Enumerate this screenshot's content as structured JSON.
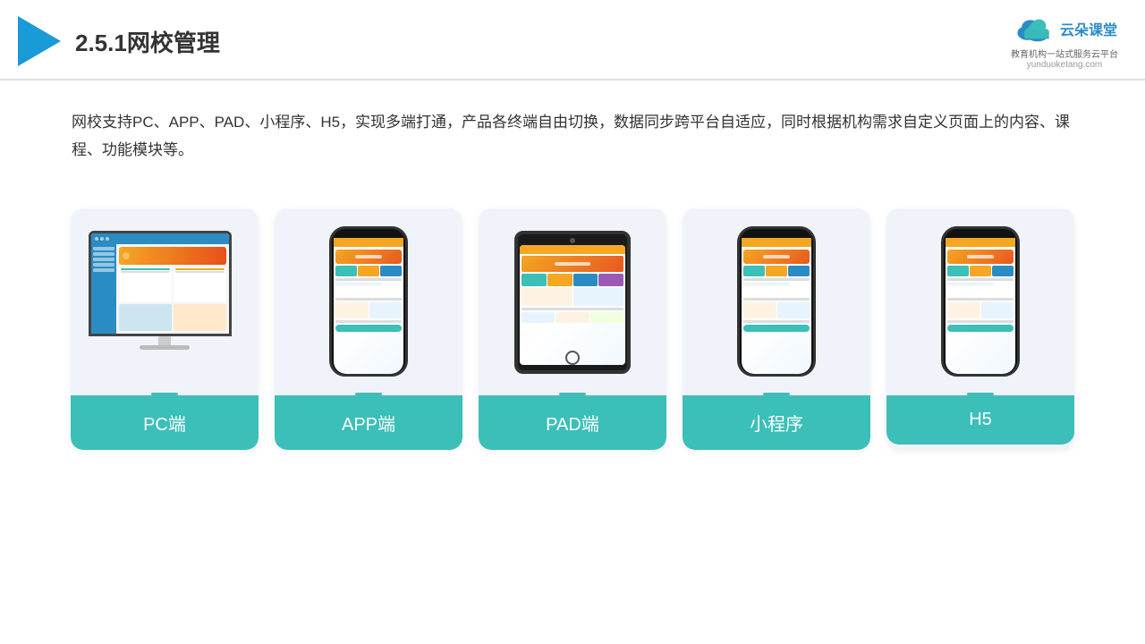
{
  "header": {
    "title": "2.5.1网校管理",
    "brand": {
      "name": "云朵课堂",
      "url": "yunduoketang.com",
      "tagline": "教育机构一站式服务云平台"
    }
  },
  "description": {
    "text": "网校支持PC、APP、PAD、小程序、H5，实现多端打通，产品各终端自由切换，数据同步跨平台自适应，同时根据机构需求自定义页面上的内容、课程、功能模块等。"
  },
  "cards": [
    {
      "id": "pc",
      "label": "PC端",
      "type": "pc"
    },
    {
      "id": "app",
      "label": "APP端",
      "type": "phone"
    },
    {
      "id": "pad",
      "label": "PAD端",
      "type": "tablet"
    },
    {
      "id": "miniprogram",
      "label": "小程序",
      "type": "phone"
    },
    {
      "id": "h5",
      "label": "H5",
      "type": "phone"
    }
  ],
  "colors": {
    "accent": "#3bbfb8",
    "blue": "#2b8cc4",
    "orange": "#f5a623"
  }
}
